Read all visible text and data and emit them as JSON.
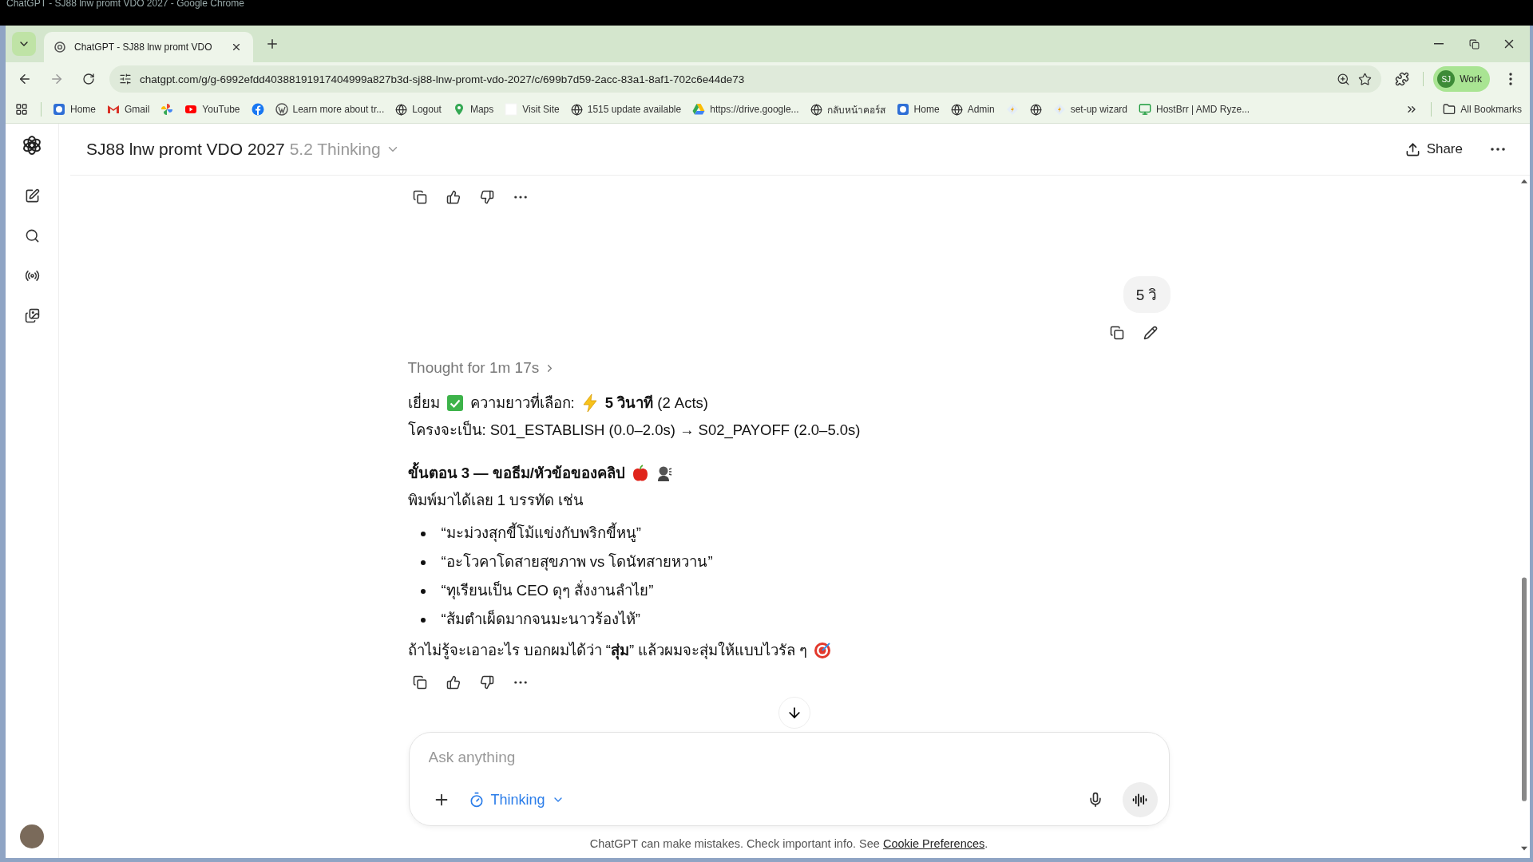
{
  "window": {
    "title": "ChatGPT - SJ88 lnw promt VDO 2027 - Google Chrome"
  },
  "browser": {
    "tabs": [
      {
        "title": "ChatGPT - SJ88 lnw promt VDO",
        "selected": true
      }
    ],
    "url": "chatgpt.com/g/g-6992efdd40388191917404999a827b3d-sj88-lnw-promt-vdo-2027/c/699b7d59-2acc-83a1-8af1-702c6e44de73",
    "profile": {
      "initials": "SJ",
      "label": "Work"
    },
    "bookmarks": [
      {
        "kind": "app",
        "label": "Home"
      },
      {
        "kind": "mail",
        "label": "Gmail"
      },
      {
        "kind": "pinwheel"
      },
      {
        "kind": "video",
        "label": "YouTube"
      },
      {
        "kind": "social"
      },
      {
        "kind": "wordpress",
        "label": "Learn more about tr..."
      },
      {
        "kind": "globe",
        "label": "Logout"
      },
      {
        "kind": "pin",
        "label": "Maps"
      },
      {
        "kind": "blank",
        "label": "Visit Site"
      },
      {
        "kind": "globe",
        "label": "1515 update available"
      },
      {
        "kind": "drive",
        "label": "https://drive.google..."
      },
      {
        "kind": "globe",
        "label": "กลับหน้าคอร์ส"
      },
      {
        "kind": "app",
        "label": "Home"
      },
      {
        "kind": "globe",
        "label": "Admin"
      },
      {
        "kind": "diamond"
      },
      {
        "kind": "globe"
      },
      {
        "kind": "diamond",
        "label": "set-up wizard"
      },
      {
        "kind": "monitor",
        "label": "HostBrr | AMD Ryze..."
      }
    ],
    "all_bookmarks": "All Bookmarks"
  },
  "chat": {
    "title": "SJ88 lnw promt VDO 2027",
    "model": "5.2 Thinking",
    "share": "Share",
    "user_message": "5 วิ",
    "thought": "Thought for 1m 17s",
    "reply": {
      "greeting": "เยี่ยม",
      "length_label": "ความยาวที่เลือก:",
      "length_value": "**5 วินาที** (2 Acts)",
      "structure": "โครงจะเป็น: S01_ESTABLISH (0.0–2.0s) → S02_PAYOFF (2.0–5.0s)",
      "heading": "ขั้นตอน 3 — ขอธีม/หัวข้อของคลิป",
      "prompt": "พิมพ์มาได้เลย 1 บรรทัด เช่น",
      "examples": [
        "“มะม่วงสุกขี้โม้แข่งกับพริกขี้หนู”",
        "“อะโวคาโดสายสุขภาพ vs โดนัทสายหวาน”",
        "“ทุเรียนเป็น CEO ดุๆ สั่งงานลำไย”",
        "“ส้มตำเผ็ดมากจนมะนาวร้องไห้”"
      ],
      "closing": "ถ้าไม่รู้จะเอาอะไร บอกผมได้ว่า “**สุ่ม**” แล้วผมจะสุ่มให้แบบไวรัล ๆ"
    },
    "composer": {
      "placeholder": "Ask anything",
      "mode": "Thinking"
    },
    "footer": {
      "text": "ChatGPT can make mistakes. Check important info. See",
      "link": "Cookie Preferences",
      "end": "."
    }
  }
}
